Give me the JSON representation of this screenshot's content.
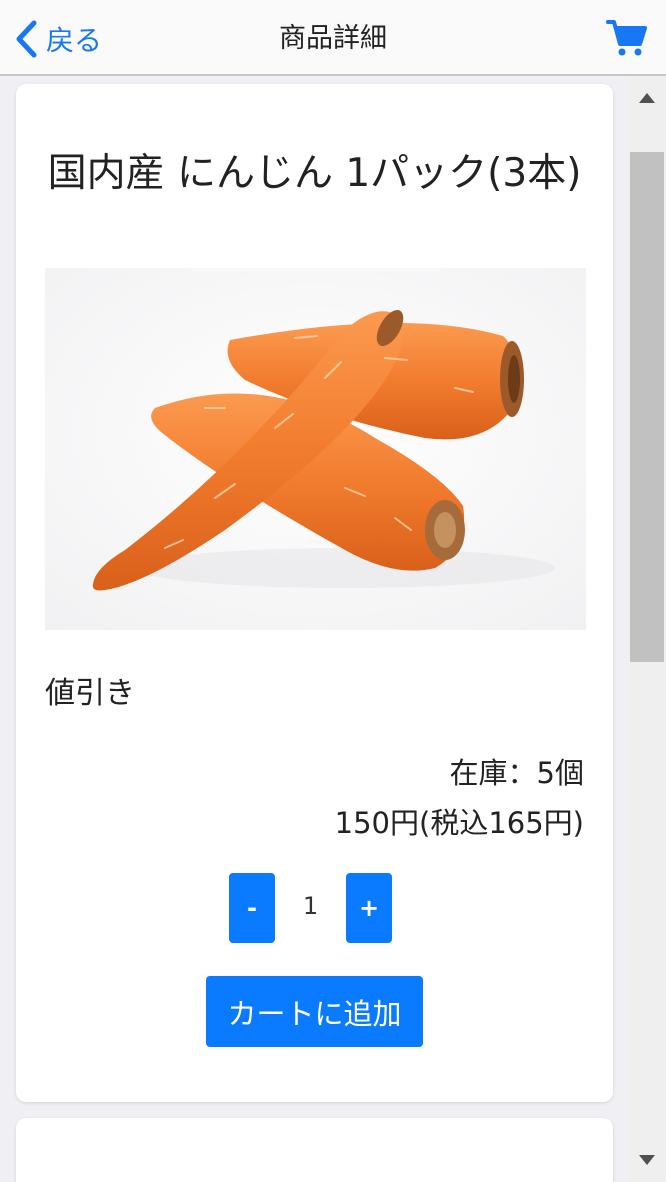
{
  "header": {
    "back_label": "戻る",
    "title": "商品詳細",
    "cart_icon": "cart-icon"
  },
  "product": {
    "name": "国内産 にんじん 1パック(3本)",
    "image_alt": "3 orange carrots on a white background",
    "tag": "値引き",
    "stock": "在庫：5個",
    "price": "150円(税込165円)",
    "quantity": "1",
    "minus_label": "-",
    "plus_label": "+",
    "add_to_cart_label": "カートに追加"
  },
  "next_card": {
    "text": ""
  },
  "colors": {
    "accent": "#0a7bff",
    "back_link": "#1877f2",
    "carrot": "#f07a2c"
  }
}
